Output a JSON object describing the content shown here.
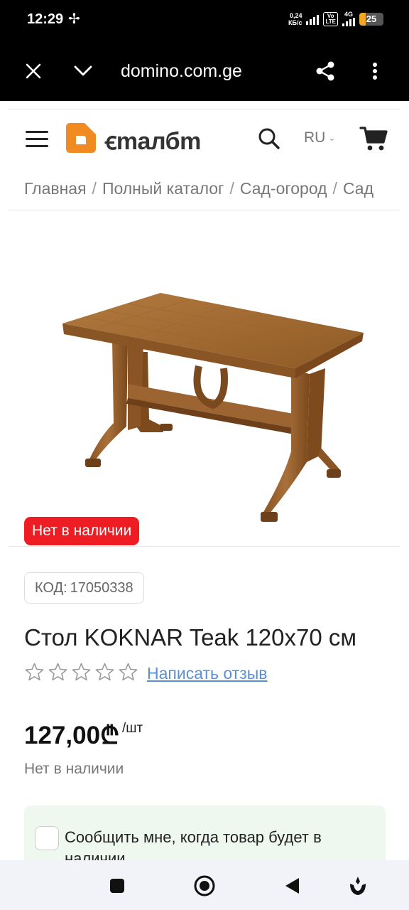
{
  "status_bar": {
    "time": "12:29",
    "net_speed_value": "0,24",
    "net_speed_unit": "КБ/с",
    "volte_line1": "Vo",
    "volte_line2": "LTE",
    "network": "4G",
    "battery": "25",
    "battery_level_percent": 25,
    "icons": [
      "fan-icon",
      "signal-icon",
      "battery-icon"
    ]
  },
  "browser": {
    "url": "domino.com.ge",
    "icons": [
      "close-icon",
      "chevron-down-icon",
      "share-icon",
      "more-vert-icon"
    ]
  },
  "header": {
    "logo_text": "ꞓmaлбm",
    "language": "RU",
    "icons": [
      "hamburger-menu-icon",
      "search-icon",
      "cart-icon"
    ],
    "brand_color": "#f18a21"
  },
  "breadcrumb": {
    "items": [
      "Главная",
      "Полный каталог",
      "Сад-огород",
      "Сад"
    ],
    "separator": "/"
  },
  "product": {
    "stock_badge": "Нет в наличии",
    "code_label": "КОД:",
    "code_value": "17050338",
    "title": "Стол KOKNAR Teak 120x70 см",
    "rating_stars": 0,
    "rating_max": 5,
    "review_link": "Написать отзыв",
    "price": "127,00",
    "currency": "₾",
    "unit": "/шт",
    "stock_text": "Нет в наличии",
    "notify_label": "Сообщить мне, когда товар будет в наличии",
    "badge_color": "#ee1d23",
    "link_color": "#5a8fd1"
  },
  "nav_bar": {
    "icons": [
      "recent-apps-icon",
      "home-icon",
      "back-icon",
      "assistant-icon"
    ]
  }
}
